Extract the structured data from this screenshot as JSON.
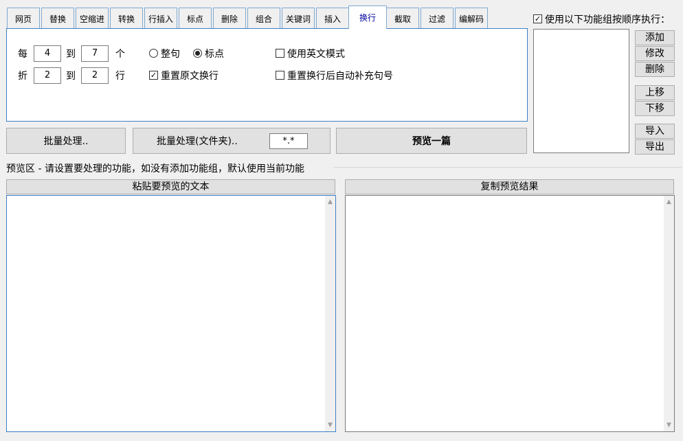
{
  "tabs": [
    "网页",
    "替换",
    "空缩进",
    "转换",
    "行插入",
    "标点",
    "删除",
    "组合",
    "关键词",
    "插入",
    "换行",
    "截取",
    "过滤",
    "编解码"
  ],
  "active_tab": "换行",
  "wrap": {
    "every_label": "每",
    "every_from": "4",
    "to_label": "到",
    "every_to": "7",
    "unit_char": "个",
    "fold_label": "折",
    "fold_from": "2",
    "fold_to_label": "到",
    "fold_to": "2",
    "unit_line": "行",
    "radio_sentence": "整句",
    "radio_punct": "标点",
    "reset_wrap": "重置原文换行",
    "english_mode": "使用英文模式",
    "auto_punct": "重置换行后自动补充句号"
  },
  "actions": {
    "batch": "批量处理..",
    "batch_folder": "批量处理(文件夹)..",
    "filter_pattern": "*.*",
    "preview_one": "预览一篇"
  },
  "preview": {
    "title": "预览区 - 请设置要处理的功能，如没有添加功能组，默认使用当前功能",
    "paste_header": "粘贴要预览的文本",
    "copy_header": "复制预览结果"
  },
  "group": {
    "use_in_order": "使用以下功能组按顺序执行：",
    "add": "添加",
    "edit": "修改",
    "delete": "删除",
    "move_up": "上移",
    "move_down": "下移",
    "import": "导入",
    "export": "导出"
  }
}
